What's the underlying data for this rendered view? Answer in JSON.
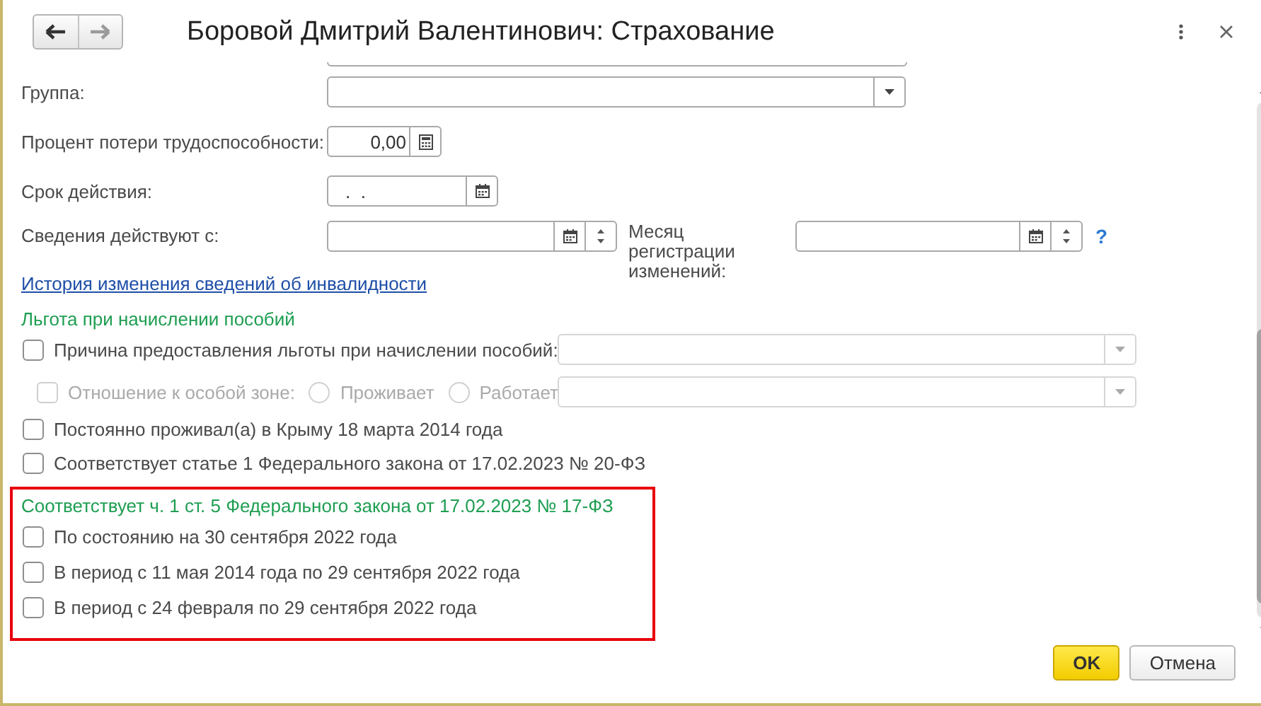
{
  "window": {
    "title": "Боровой Дмитрий Валентинович: Страхование"
  },
  "nav": [
    {
      "kind": "back",
      "disabled": false
    },
    {
      "kind": "forward",
      "disabled": true
    }
  ],
  "fields": [
    {
      "kind": "select",
      "label": "Группа:"
    },
    {
      "kind": "number",
      "label": "Процент потери трудоспособности:",
      "value": "0,00"
    },
    {
      "kind": "date",
      "label": "Срок действия:",
      "value": ".  ."
    },
    {
      "kind": "date_spin",
      "label": "Сведения действуют с:",
      "extra": {
        "label": "Месяц регистрации изменений:",
        "help": "?"
      }
    }
  ],
  "link": "История изменения сведений об инвалидности",
  "benefits": {
    "title": "Льгота при начислении пособий",
    "rows": [
      {
        "kind": "checkbox_select",
        "label": "Причина предоставления льготы при начислении пособий:",
        "checked": false,
        "disabled": false
      },
      {
        "kind": "zone",
        "label": "Отношение к особой зоне:",
        "checked": false,
        "disabled": true,
        "options": [
          {
            "label": "Проживает",
            "selected": false
          },
          {
            "label": "Работает",
            "selected": false
          }
        ]
      },
      {
        "kind": "checkbox",
        "label": "Постоянно проживал(а) в Крыму 18 марта 2014 года",
        "checked": false,
        "disabled": false
      },
      {
        "kind": "checkbox",
        "label": "Соответствует статье 1 Федерального закона от 17.02.2023 № 20-ФЗ",
        "checked": false,
        "disabled": false
      }
    ]
  },
  "law_group": {
    "title": "Соответствует ч. 1 ст. 5 Федерального закона от 17.02.2023 № 17-ФЗ",
    "highlighted": true,
    "rows": [
      {
        "label": "По состоянию на 30 сентября 2022 года",
        "checked": false
      },
      {
        "label": "В период с 11 мая 2014 года по 29 сентября 2022 года",
        "checked": false
      },
      {
        "label": "В период с 24 февраля по 29 сентября 2022 года",
        "checked": false
      }
    ]
  },
  "buttons": [
    {
      "label": "OK",
      "default": true
    },
    {
      "label": "Отмена",
      "default": false
    }
  ]
}
